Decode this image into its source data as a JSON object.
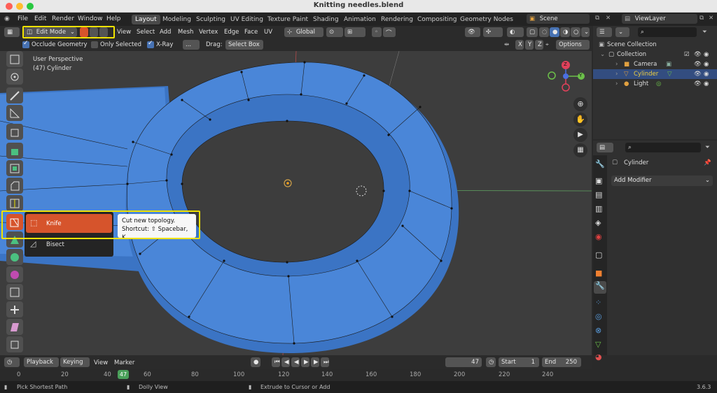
{
  "window": {
    "title": "Knitting needles.blend"
  },
  "menu": [
    "File",
    "Edit",
    "Render",
    "Window",
    "Help"
  ],
  "workspaces": [
    "Layout",
    "Modeling",
    "Sculpting",
    "UV Editing",
    "Texture Paint",
    "Shading",
    "Animation",
    "Rendering",
    "Compositing",
    "Geometry Nodes"
  ],
  "active_workspace": "Layout",
  "scene": {
    "label": "Scene",
    "view_layer": "ViewLayer"
  },
  "header": {
    "mode": "Edit Mode",
    "items": [
      "View",
      "Select",
      "Add",
      "Mesh",
      "Vertex",
      "Edge",
      "Face",
      "UV"
    ],
    "orientation": "Global"
  },
  "subheader": {
    "occlude_geometry": "Occlude Geometry",
    "only_selected": "Only Selected",
    "xray": "X-Ray",
    "dots": "...",
    "drag_label": "Drag:",
    "drag_value": "Select Box",
    "axes": [
      "X",
      "Y",
      "Z"
    ],
    "options": "Options"
  },
  "viewport": {
    "perspective": "User Perspective",
    "object": "(47) Cylinder"
  },
  "tool_menu": {
    "items": [
      "Knife",
      "Bisect"
    ],
    "tooltip_line1": "Cut new topology.",
    "tooltip_line2": "Shortcut: ⇧ Spacebar, K"
  },
  "gizmo": {
    "x": "X",
    "y": "Y",
    "z": "Z"
  },
  "outliner": {
    "root": "Scene Collection",
    "collection": "Collection",
    "items": [
      "Camera",
      "Cylinder",
      "Light"
    ]
  },
  "properties": {
    "object_name": "Cylinder",
    "add_modifier": "Add Modifier"
  },
  "timeline": {
    "playback": "Playback",
    "keying": "Keying",
    "view": "View",
    "marker": "Marker",
    "current_frame": "47",
    "start_label": "Start",
    "start": "1",
    "end_label": "End",
    "end": "250",
    "ticks": [
      "0",
      "20",
      "40",
      "60",
      "80",
      "100",
      "120",
      "140",
      "160",
      "180",
      "200",
      "220",
      "240"
    ],
    "current_marker": "47"
  },
  "status": {
    "left": "Pick Shortest Path",
    "mid": "Dolly View",
    "right": "Extrude to Cursor or Add",
    "version": "3.6.3"
  },
  "colors": {
    "mesh": "#4a86d8",
    "mesh_dark": "#3b74c4",
    "accent": "#4772b3",
    "active_tool": "#d6542c",
    "highlight": "#f1e300"
  }
}
